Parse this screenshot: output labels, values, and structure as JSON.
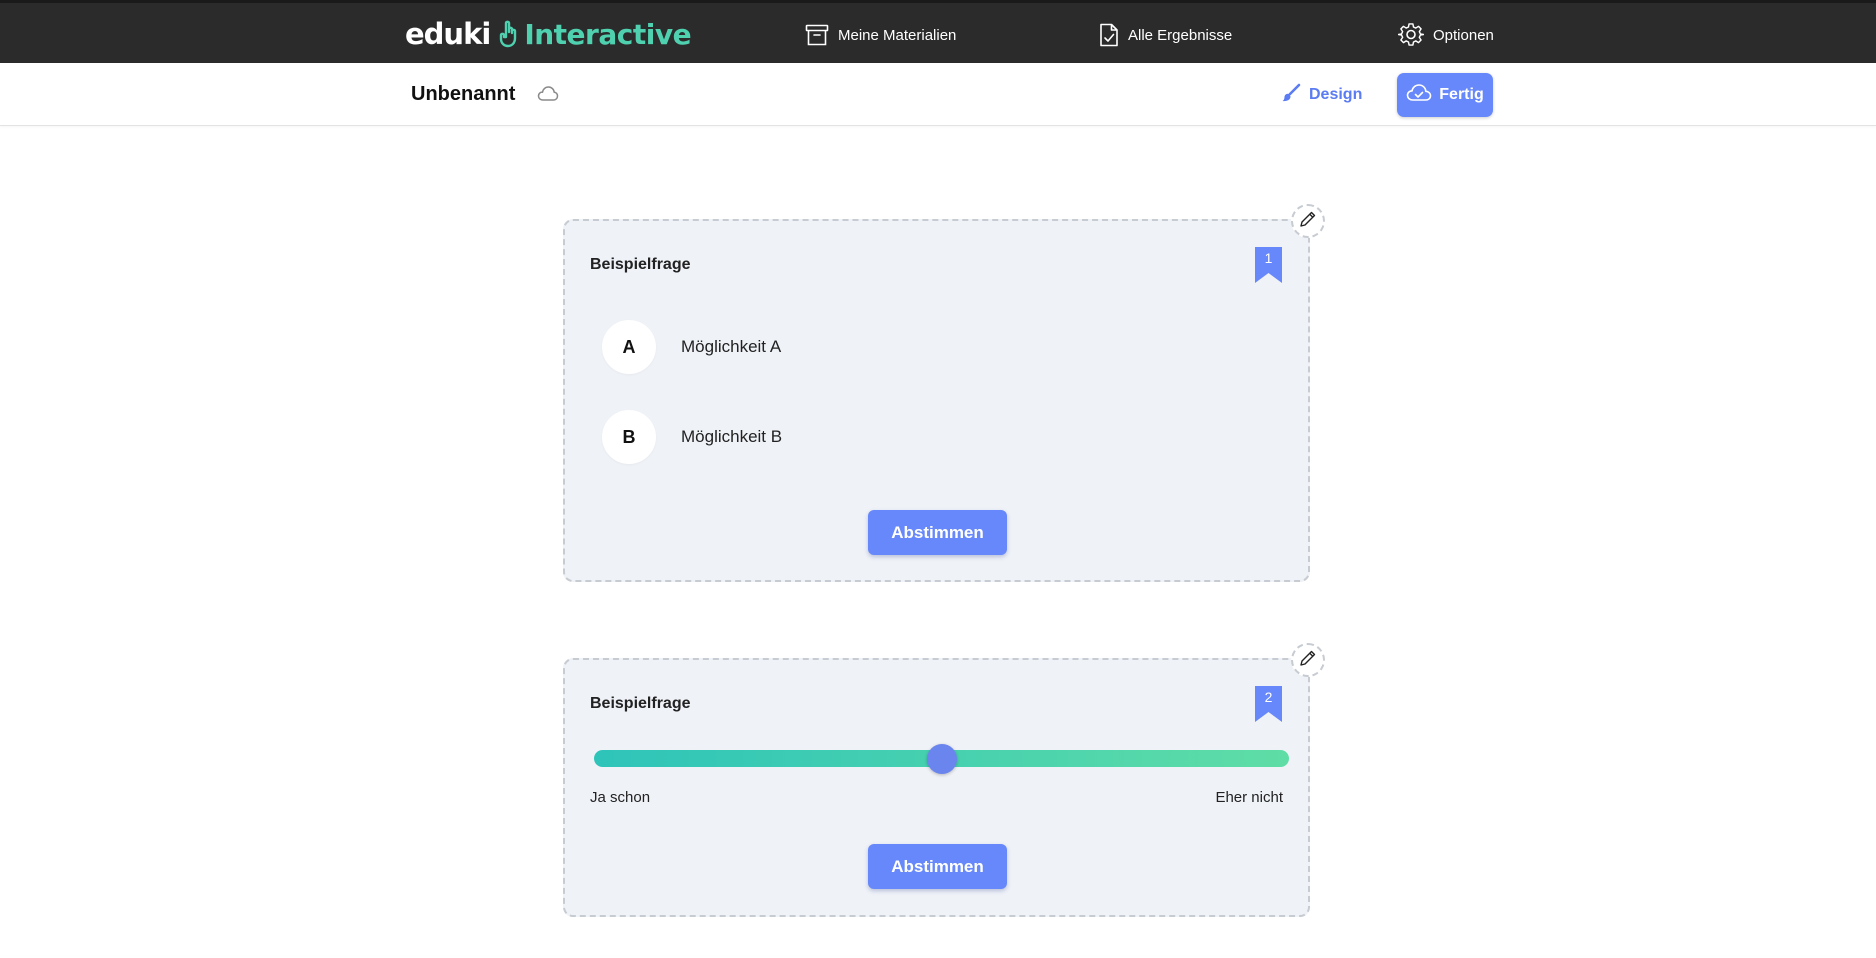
{
  "app": {
    "logo_left": "eduki",
    "logo_right": "Interactive"
  },
  "nav": {
    "materialien": "Meine Materialien",
    "ergebnisse": "Alle Ergebnisse",
    "optionen": "Optionen"
  },
  "toolbar": {
    "document_title": "Unbenannt",
    "design_label": "Design",
    "done_label": "Fertig"
  },
  "questions": [
    {
      "title": "Beispielfrage",
      "number": "1",
      "type": "multiple-choice",
      "options": [
        {
          "letter": "A",
          "text": "Möglichkeit A"
        },
        {
          "letter": "B",
          "text": "Möglichkeit B"
        }
      ],
      "vote_label": "Abstimmen"
    },
    {
      "title": "Beispielfrage",
      "number": "2",
      "type": "slider",
      "slider_value": 0.5,
      "label_left": "Ja schon",
      "label_right": "Eher nicht",
      "vote_label": "Abstimmen"
    }
  ],
  "colors": {
    "accent": "#6788fa",
    "brand_green": "#4fd1b0",
    "topbar": "#2b2b2b",
    "card_bg": "#eff2f7",
    "slider_start": "#2ec4b9",
    "slider_end": "#5fdda6"
  },
  "icons": {
    "materialien": "archive-box-icon",
    "ergebnisse": "document-check-icon",
    "optionen": "gear-icon",
    "cloud_status": "cloud-icon",
    "design": "brush-icon",
    "done": "cloud-check-icon",
    "edit": "pencil-icon",
    "badge": "bookmark-icon"
  }
}
